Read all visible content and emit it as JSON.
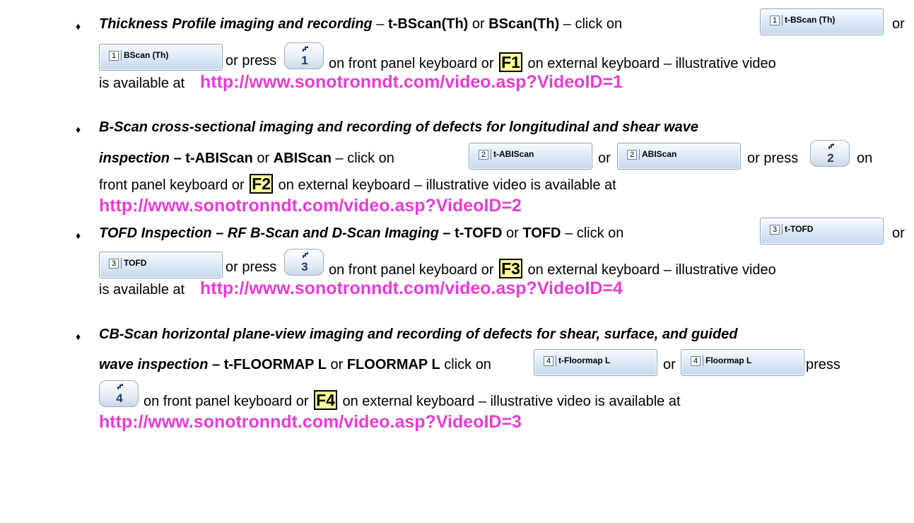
{
  "items": [
    {
      "bullet": "♦",
      "title": "Thickness Profile imaging and recording",
      "sep1": " – ",
      "mode_t": "t-BScan(Th)",
      "or1": " or ",
      "mode": "BScan(Th)",
      "sep2": " – click on",
      "btn_t": {
        "num": "1",
        "label": "t-BScan (Th)"
      },
      "or2": "or",
      "btn": {
        "num": "1",
        "label": "BScan (Th)"
      },
      "or_press": "or press",
      "key": "1",
      "front_panel": "on front panel keyboard or",
      "fkey": "F1",
      "ext": "on external keyboard – illustrative video",
      "avail": "is available at",
      "url": "http://www.sonotronndt.com/video.asp?VideoID=1"
    },
    {
      "bullet": "♦",
      "title_l1": "B-Scan cross-sectional imaging and recording of defects for longitudinal and shear wave",
      "title_l2": "inspection",
      "sep1": " – ",
      "mode_t": "t-ABIScan",
      "or1": " or ",
      "mode": "ABIScan",
      "sep2": " – click on",
      "btn_t": {
        "num": "2",
        "label": "t-ABIScan"
      },
      "or2": "or",
      "btn": {
        "num": "2",
        "label": "ABIScan"
      },
      "or_press": "or press",
      "key": "2",
      "on": "on",
      "front_panel": "front panel keyboard or",
      "fkey": "F2",
      "ext": "on external keyboard – illustrative video is available at",
      "url": "http://www.sonotronndt.com/video.asp?VideoID=2"
    },
    {
      "bullet": "♦",
      "title": "TOFD Inspection – RF B-Scan and D-Scan Imaging",
      "sep1": " – ",
      "mode_t": "t-TOFD",
      "or1": " or ",
      "mode": "TOFD",
      "sep2": " – click on",
      "btn_t": {
        "num": "3",
        "label": "t-TOFD"
      },
      "or2": "or",
      "btn": {
        "num": "3",
        "label": "TOFD"
      },
      "or_press": "or press",
      "key": "3",
      "front_panel": "on front panel keyboard or",
      "fkey": "F3",
      "ext": "on external keyboard – illustrative video",
      "avail": "is available at",
      "url": "http://www.sonotronndt.com/video.asp?VideoID=4"
    },
    {
      "bullet": "♦",
      "title_l1": "CB-Scan horizontal plane-view imaging and recording of defects for shear, surface, and guided",
      "title_l2": "wave inspection",
      "sep1": " – ",
      "mode_t": "t-FLOORMAP L",
      "or1": " or ",
      "mode": "FLOORMAP L",
      "sep2": " click on",
      "btn_t": {
        "num": "4",
        "label": "t-Floormap L"
      },
      "or2": "or",
      "btn": {
        "num": "4",
        "label": "Floormap L"
      },
      "press": "press",
      "key": "4",
      "front_panel": "on front panel keyboard or",
      "fkey": "F4",
      "ext": "on external keyboard – illustrative video is available at",
      "url": "http://www.sonotronndt.com/video.asp?VideoID=3"
    }
  ],
  "colors": {
    "link": "#ea3bd6",
    "fkey_bg": "#ffff99",
    "button": "#d9e7f6"
  }
}
